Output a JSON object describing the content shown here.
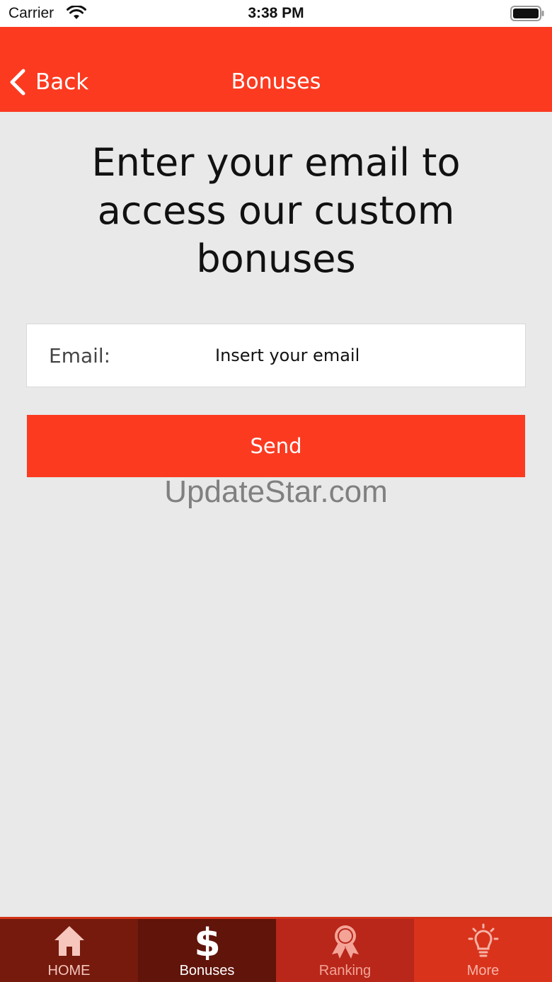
{
  "status_bar": {
    "carrier": "Carrier",
    "time": "3:38 PM"
  },
  "nav": {
    "back_label": "Back",
    "title": "Bonuses"
  },
  "content": {
    "heading": "Enter your email to access our custom bonuses",
    "email_label": "Email:",
    "email_placeholder": "Insert your email",
    "email_value": "",
    "send_label": "Send",
    "watermark": "UpdateStar.com"
  },
  "tabs": [
    {
      "label": "HOME",
      "icon": "home-icon",
      "bg": "#751a0d",
      "color": "#f6c6bd"
    },
    {
      "label": "Bonuses",
      "icon": "dollar-icon",
      "bg": "#60140a",
      "color": "#ffffff",
      "selected": true
    },
    {
      "label": "Ranking",
      "icon": "award-icon",
      "bg": "#b8271a",
      "color": "#f3a497"
    },
    {
      "label": "More",
      "icon": "lightbulb-icon",
      "bg": "#d9331c",
      "color": "#f6b3a6"
    }
  ],
  "colors": {
    "accent": "#fc3a20",
    "background": "#e9e9e9"
  }
}
